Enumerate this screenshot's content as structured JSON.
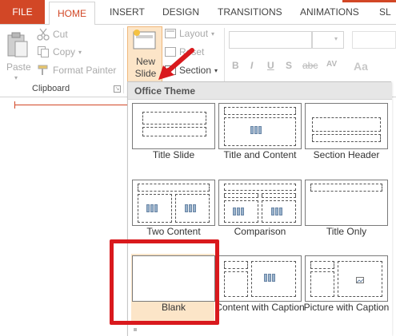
{
  "tabs": {
    "file": "FILE",
    "home": "HOME",
    "insert": "INSERT",
    "design": "DESIGN",
    "transitions": "TRANSITIONS",
    "animations": "ANIMATIONS",
    "overflow": "SL"
  },
  "clipboard": {
    "paste": "Paste",
    "cut": "Cut",
    "copy": "Copy",
    "format_painter": "Format Painter",
    "group_label": "Clipboard"
  },
  "slides": {
    "new_slide_line1": "New",
    "new_slide_line2": "Slide",
    "layout": "Layout",
    "reset": "Reset",
    "section": "Section"
  },
  "font_format": {
    "bold": "B",
    "italic": "I",
    "underline": "U",
    "shadow": "S",
    "strike": "abc",
    "spacing": "AV"
  },
  "gallery": {
    "heading": "Office Theme",
    "layouts": [
      {
        "label": "Title Slide"
      },
      {
        "label": "Title and Content"
      },
      {
        "label": "Section Header"
      },
      {
        "label": "Two Content"
      },
      {
        "label": "Comparison"
      },
      {
        "label": "Title Only"
      },
      {
        "label": "Blank"
      },
      {
        "label": "Content with Caption"
      },
      {
        "label": "Picture with Caption"
      }
    ]
  },
  "colors": {
    "accent": "#d24726",
    "highlight": "#fce5c8",
    "annotation": "#d9191d"
  }
}
